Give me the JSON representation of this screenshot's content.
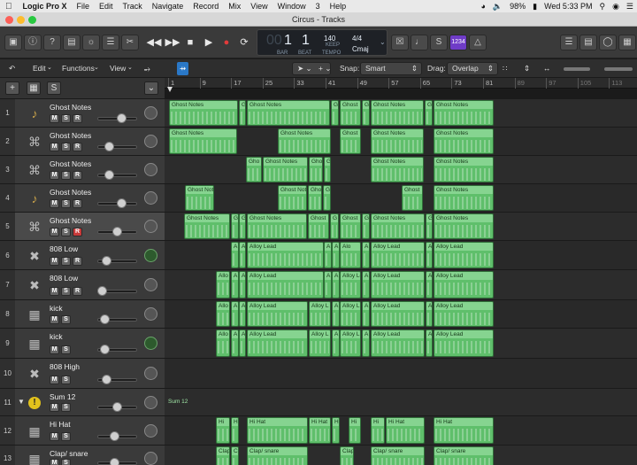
{
  "menubar": {
    "app": "Logic Pro X",
    "items": [
      "File",
      "Edit",
      "Track",
      "Navigate",
      "Record",
      "Mix",
      "View",
      "Window",
      "3",
      "Help"
    ],
    "battery": "98%",
    "clock": "Wed 5:33 PM"
  },
  "window": {
    "title": "Circus - Tracks"
  },
  "lcd": {
    "bar": "1",
    "beat": "1",
    "bar_label": "BAR",
    "beat_label": "BEAT",
    "tempo": "140",
    "keep_label": "KEEP",
    "tempo_label": "TEMPO",
    "signature": "4/4",
    "key": "Cmaj",
    "lcd_dim": "00"
  },
  "control": {
    "count_in": "1234"
  },
  "trackbar": {
    "edit": "Edit",
    "functions": "Functions",
    "view": "View",
    "snap_label": "Snap:",
    "snap_value": "Smart",
    "drag_label": "Drag:",
    "drag_value": "Overlap"
  },
  "ruler": {
    "ticks": [
      "1",
      "9",
      "17",
      "25",
      "33",
      "41",
      "49",
      "57",
      "65",
      "73",
      "81",
      "89",
      "97",
      "105",
      "113"
    ]
  },
  "tracks": [
    {
      "num": "1",
      "name": "Ghost Notes",
      "icon": "guitar-icon",
      "buttons": [
        "M",
        "S",
        "R"
      ]
    },
    {
      "num": "2",
      "name": "Ghost Notes",
      "icon": "keyboard-icon",
      "buttons": [
        "M",
        "S",
        "R"
      ]
    },
    {
      "num": "3",
      "name": "Ghost Notes",
      "icon": "keyboard-icon",
      "buttons": [
        "M",
        "S",
        "R"
      ]
    },
    {
      "num": "4",
      "name": "Ghost Notes",
      "icon": "guitar-icon",
      "buttons": [
        "M",
        "S",
        "R"
      ]
    },
    {
      "num": "5",
      "name": "Ghost Notes",
      "icon": "keyboard-icon",
      "buttons": [
        "M",
        "S",
        "R"
      ]
    },
    {
      "num": "6",
      "name": "808 Low",
      "icon": "drum-stand-icon",
      "buttons": [
        "M",
        "S",
        "R"
      ]
    },
    {
      "num": "7",
      "name": "808 Low",
      "icon": "drum-stand-icon",
      "buttons": [
        "M",
        "S",
        "R"
      ]
    },
    {
      "num": "8",
      "name": "kick",
      "icon": "drum-machine-icon",
      "buttons": [
        "M",
        "S"
      ]
    },
    {
      "num": "9",
      "name": "kick",
      "icon": "drum-machine-icon",
      "buttons": [
        "M",
        "S"
      ]
    },
    {
      "num": "10",
      "name": "808 High",
      "icon": "drum-stand-icon",
      "buttons": [
        "M",
        "S"
      ]
    },
    {
      "num": "11",
      "name": "Sum 12",
      "icon": "summing-stack-icon",
      "buttons": [
        "M",
        "S"
      ]
    },
    {
      "num": "12",
      "name": "Hi Hat",
      "icon": "drum-machine-icon",
      "buttons": [
        "M",
        "S"
      ]
    },
    {
      "num": "13",
      "name": "Clap/ snare",
      "icon": "drum-machine-icon",
      "buttons": [
        "M",
        "S"
      ]
    }
  ],
  "regions": {
    "ghost_notes": "Ghost Notes",
    "ghost_not": "Ghost Not",
    "ghost": "Ghost",
    "gho": "Gho",
    "g": "G",
    "alloy_lead": "Alloy Lead",
    "allo": "Allo",
    "alloy_l": "Alloy L",
    "alo": "Alo",
    "a": "A",
    "sum_12": "Sum 12",
    "hi_hat": "Hi Hat",
    "hi": "Hi",
    "h": "H",
    "clap_snare": "Clap/ snare",
    "clap": "Clap",
    "c": "C"
  }
}
